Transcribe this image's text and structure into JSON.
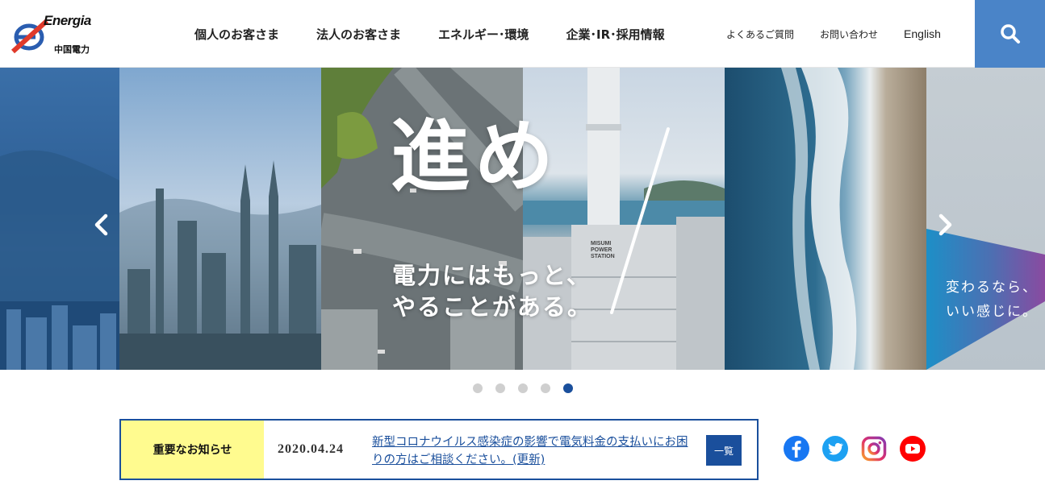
{
  "logo": {
    "en": "Energia",
    "jp": "中国電力"
  },
  "nav": {
    "items": [
      "個人のお客さま",
      "法人のお客さま",
      "エネルギー･環境",
      "企業･IR･採用情報"
    ],
    "sub": [
      "よくあるご質問",
      "お問い合わせ",
      "English"
    ]
  },
  "hero": {
    "headline": "進め",
    "sub_line1": "電力にはもっと、",
    "sub_line2": "やることがある。",
    "right_line1": "変わるなら、",
    "right_line2": "いい感じに。",
    "building_sign": "MISUMI POWER STATION"
  },
  "carousel": {
    "slides": 5,
    "active": 5
  },
  "notice": {
    "label": "重要なお知らせ",
    "date": "2020.04.24",
    "text": "新型コロナウイルス感染症の影響で電気料金の支払いにお困りの方はご相談ください。(更新)",
    "more": "一覧"
  },
  "colors": {
    "accent": "#1a4f9c",
    "search_bg": "#4a84c8",
    "notice_label_bg": "#fffb8f",
    "facebook": "#1877f2",
    "twitter": "#1da1f2",
    "youtube": "#ff0000"
  },
  "icons": [
    "search-icon",
    "chevron-left-icon",
    "chevron-right-icon",
    "facebook-icon",
    "twitter-icon",
    "instagram-icon",
    "youtube-icon"
  ]
}
